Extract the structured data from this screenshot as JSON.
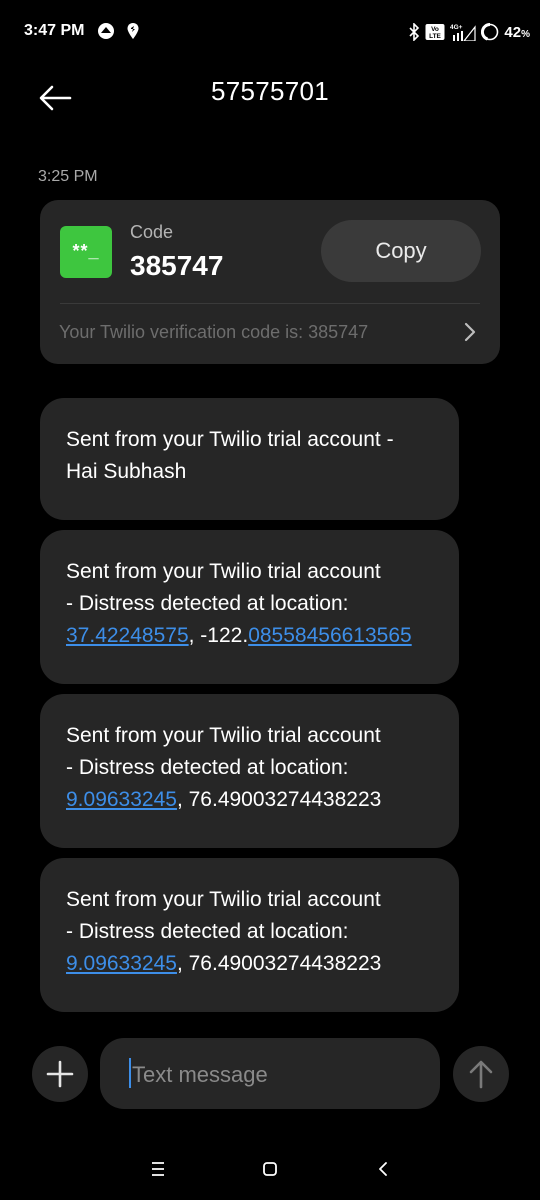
{
  "status_bar": {
    "time": "3:47 PM",
    "battery_percent": "42",
    "battery_unit": "%",
    "network_label": "4G+",
    "volte_label": "Vo LTE",
    "icons": [
      "whatsapp-icon",
      "location-icon",
      "bluetooth-icon",
      "volte-icon",
      "signal-icon",
      "battery-icon"
    ]
  },
  "header": {
    "title": "57575701",
    "back_icon": "arrow-left-icon"
  },
  "timestamp": "3:25 PM",
  "otp_card": {
    "icon_text": "**_",
    "label": "Code",
    "code": "385747",
    "copy_label": "Copy",
    "preview": "Your Twilio verification code is: 385747",
    "icon_color": "#3ec63f"
  },
  "messages": [
    {
      "line1": "Sent from your Twilio trial account -",
      "line2": "Hai Subhash"
    },
    {
      "line1": "Sent from your Twilio trial account",
      "line2": "- Distress detected at location:",
      "coord_link1": "37.42248575",
      "coord_mid": ", -122.",
      "coord_link2": "08558456613565"
    },
    {
      "line1": "Sent from your Twilio trial account",
      "line2": "- Distress detected at location:",
      "coord_link1": "9.09633245",
      "coord_rest": ", 76.49003274438223"
    },
    {
      "line1": "Sent from your Twilio trial account",
      "line2": "- Distress detected at location:",
      "coord_link1": "9.09633245",
      "coord_rest": ", 76.49003274438223"
    }
  ],
  "compose": {
    "placeholder": "Text message",
    "value": ""
  },
  "colors": {
    "background": "#000000",
    "bubble": "#262626",
    "link": "#3d8ee8",
    "accent_green": "#3ec63f"
  }
}
